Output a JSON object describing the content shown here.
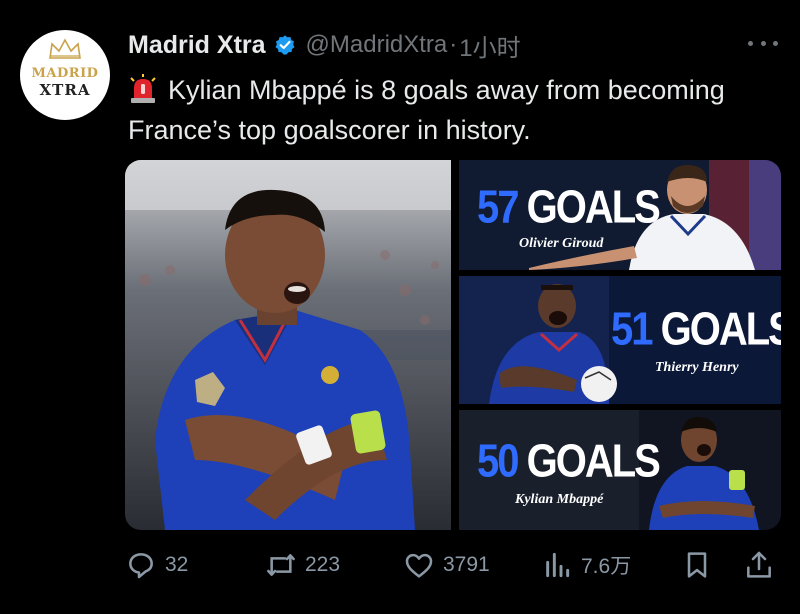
{
  "account": {
    "avatar_line1": "MADRID",
    "avatar_line2": "XTRA",
    "name": "Madrid Xtra",
    "handle": "@MadridXtra",
    "separator": "·",
    "time": "1小时"
  },
  "tweet": {
    "text": "Kylian Mbappé is 8 goals away from becoming France’s top goalscorer in history."
  },
  "media": {
    "panels": [
      {
        "goals_number": "57",
        "goals_word": "GOALS",
        "player": "Olivier Giroud"
      },
      {
        "goals_number": "51",
        "goals_word": "GOALS",
        "player": "Thierry Henry"
      },
      {
        "goals_number": "50",
        "goals_word": "GOALS",
        "player": "Kylian Mbappé"
      }
    ]
  },
  "actions": {
    "replies": "32",
    "reposts": "223",
    "likes": "3791",
    "views": "7.6万"
  },
  "icons": [
    "verified-badge-icon",
    "more-icon",
    "siren-emoji-icon",
    "reply-icon",
    "repost-icon",
    "like-icon",
    "views-icon",
    "bookmark-icon",
    "share-icon"
  ],
  "colors": {
    "background": "#000000",
    "text": "#e7e9ea",
    "muted": "#71767b",
    "verified": "#1d9bf0",
    "goals_blue": "#2f6bff"
  }
}
